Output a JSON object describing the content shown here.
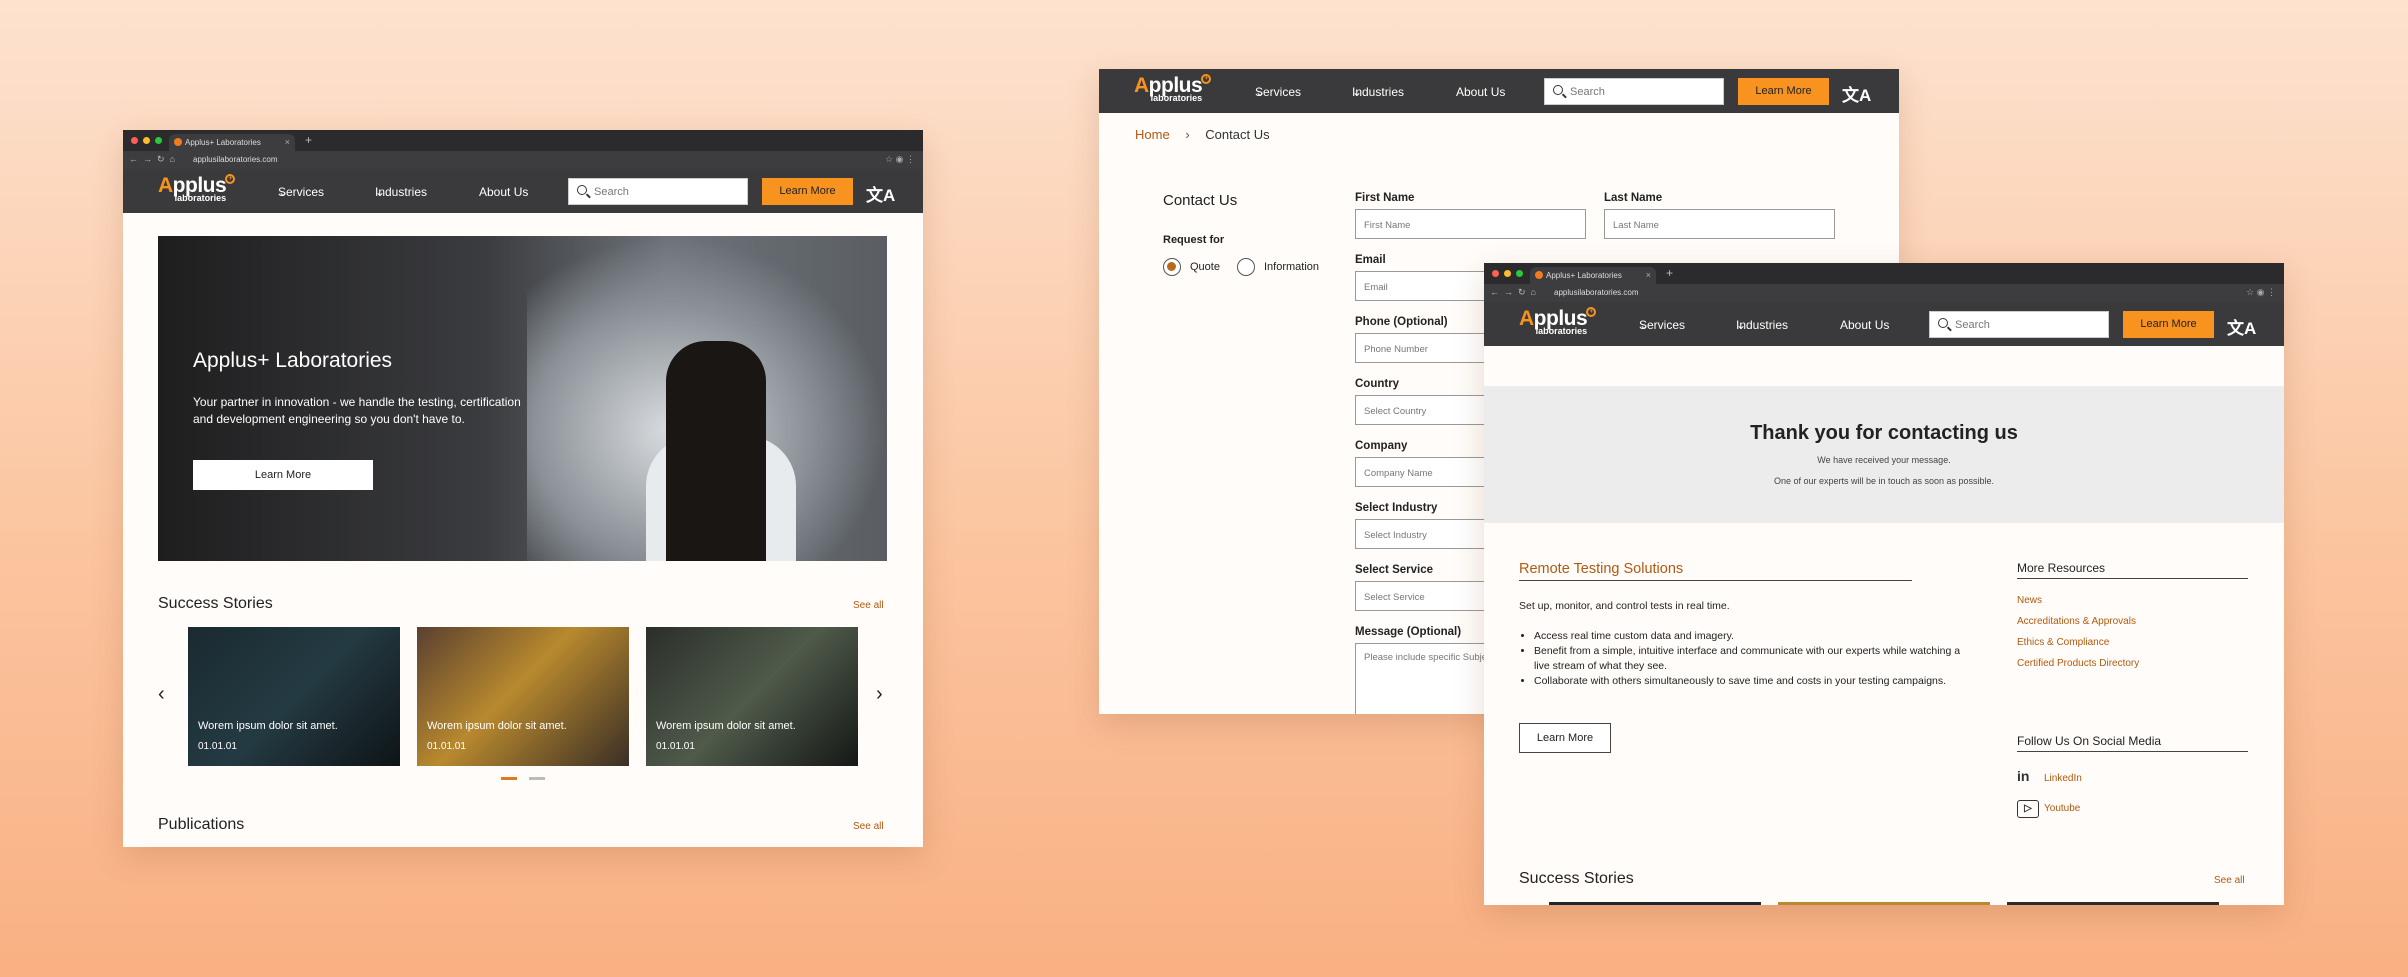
{
  "colors": {
    "accent": "#f7931e",
    "link": "#b15a0f",
    "header_bg": "#3a3a3c",
    "page_bg": "#fbc5a0"
  },
  "browser": {
    "tab_title": "Applus+ Laboratories",
    "url": "applusilaboratories.com",
    "url_right": "applusilaboratories.com"
  },
  "header": {
    "logo_main_a": "A",
    "logo_main_rest": "pplus",
    "logo_sub": "laboratories",
    "nav": {
      "services": "Services",
      "industries": "Industries",
      "about": "About Us"
    },
    "search_placeholder": "Search",
    "learn_more": "Learn More",
    "lang_icon": "文A"
  },
  "home": {
    "hero": {
      "title": "Applus+ Laboratories",
      "text": "Your partner in innovation - we handle the testing, certification and development engineering so you don't have to.",
      "button": "Learn More"
    },
    "success_title": "Success Stories",
    "see_all": "See all",
    "cards": [
      {
        "title": "Worem ipsum dolor sit amet.",
        "date": "01.01.01"
      },
      {
        "title": "Worem ipsum dolor sit amet.",
        "date": "01.01.01"
      },
      {
        "title": "Worem ipsum dolor sit amet.",
        "date": "01.01.01"
      }
    ],
    "publications_title": "Publications",
    "publications_see_all": "See all"
  },
  "contact": {
    "crumb_home": "Home",
    "crumb_sep": "›",
    "crumb_current": "Contact Us",
    "heading": "Contact Us",
    "request_for": "Request for",
    "radio_quote": "Quote",
    "radio_info": "Information",
    "first_name_label": "First Name",
    "first_name_ph": "First Name",
    "last_name_label": "Last Name",
    "last_name_ph": "Last Name",
    "email_label": "Email",
    "email_ph": "Email",
    "phone_label": "Phone (Optional)",
    "phone_ph": "Phone Number",
    "country_label": "Country",
    "country_ph": "Select Country",
    "company_label": "Company",
    "company_ph": "Company Name",
    "industry_label": "Select Industry",
    "industry_ph": "Select Industry",
    "service_label": "Select Service",
    "service_ph": "Select Service",
    "message_label": "Message (Optional)",
    "message_ph": "Please include specific Subje"
  },
  "thanks": {
    "title": "Thank you for contacting us",
    "line1": "We have received your message.",
    "line2": "One of our experts will be in touch as soon as possible.",
    "rts_title": "Remote Testing Solutions",
    "rts_intro": "Set up, monitor, and control tests in real time.",
    "bullets": [
      "Access real time custom data and imagery.",
      "Benefit from a simple, intuitive interface and communicate with our experts while watching a live stream of what they see.",
      "Collaborate with others simultaneously to save time and costs in your testing campaigns."
    ],
    "learn_more": "Learn More",
    "more_resources": "More Resources",
    "resources": [
      "News",
      "Accreditations & Approvals",
      "Ethics & Compliance",
      "Certified Products Directory"
    ],
    "follow": "Follow Us On Social Media",
    "linkedin": "LinkedIn",
    "youtube": "Youtube",
    "success_title": "Success Stories",
    "see_all": "See all"
  }
}
